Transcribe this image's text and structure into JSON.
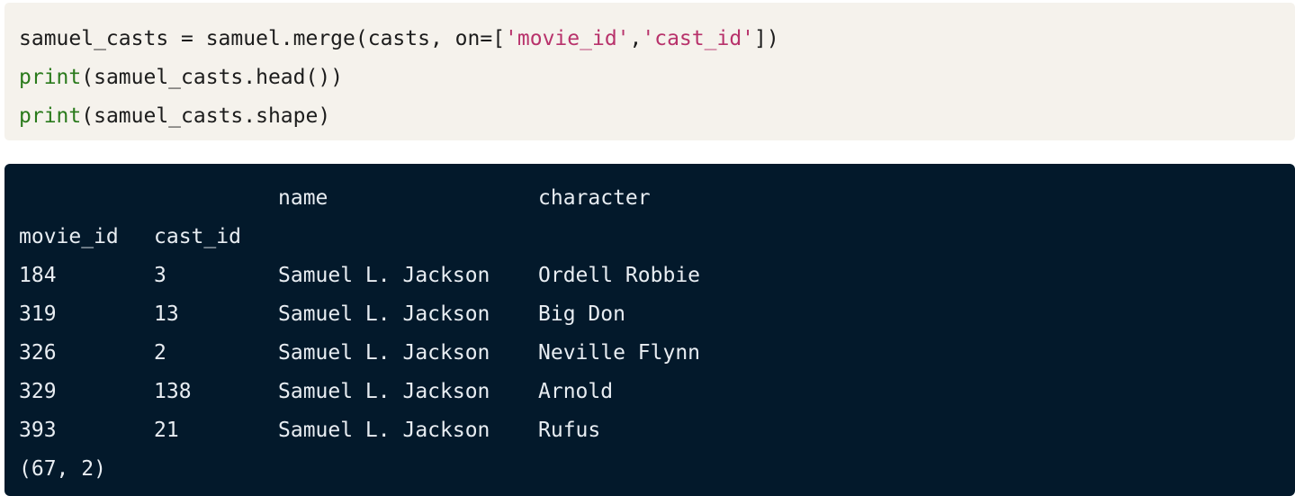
{
  "code": {
    "lines": [
      [
        {
          "text": "samuel_casts = samuel.merge(casts, on=[",
          "kind": "plain"
        },
        {
          "text": "'movie_id'",
          "kind": "string"
        },
        {
          "text": ",",
          "kind": "plain"
        },
        {
          "text": "'cast_id'",
          "kind": "string"
        },
        {
          "text": "])",
          "kind": "plain"
        }
      ],
      [
        {
          "text": "print",
          "kind": "builtin"
        },
        {
          "text": "(samuel_casts.head())",
          "kind": "plain"
        }
      ],
      [
        {
          "text": "print",
          "kind": "builtin"
        },
        {
          "text": "(samuel_casts.shape)",
          "kind": "plain"
        }
      ]
    ]
  },
  "output": {
    "column_headers": {
      "name": "name",
      "character": "character"
    },
    "index_headers": {
      "movie_id": "movie_id",
      "cast_id": "cast_id"
    },
    "rows": [
      {
        "movie_id": "184",
        "cast_id": "3",
        "name": "Samuel L. Jackson",
        "character": "Ordell Robbie"
      },
      {
        "movie_id": "319",
        "cast_id": "13",
        "name": "Samuel L. Jackson",
        "character": "Big Don"
      },
      {
        "movie_id": "326",
        "cast_id": "2",
        "name": "Samuel L. Jackson",
        "character": "Neville Flynn"
      },
      {
        "movie_id": "329",
        "cast_id": "138",
        "name": "Samuel L. Jackson",
        "character": "Arnold"
      },
      {
        "movie_id": "393",
        "cast_id": "21",
        "name": "Samuel L. Jackson",
        "character": "Rufus"
      }
    ],
    "shape": "(67, 2)"
  },
  "colors": {
    "code_background": "#f5f2ec",
    "output_background": "#03192b",
    "builtin": "#2a7a1c",
    "string": "#b8326b"
  }
}
